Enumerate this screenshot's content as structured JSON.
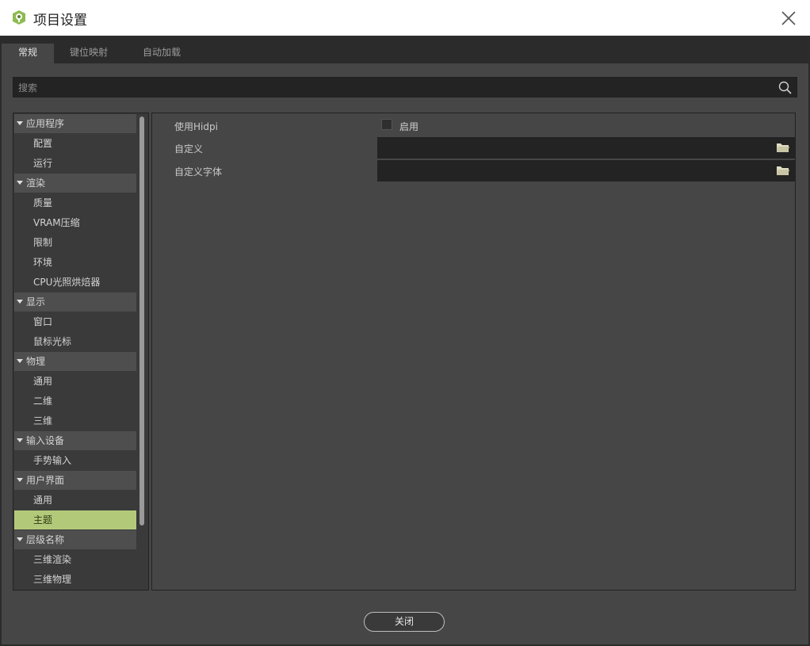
{
  "window": {
    "title": "项目设置"
  },
  "tabs": [
    {
      "label": "常规",
      "active": true
    },
    {
      "label": "键位映射",
      "active": false
    },
    {
      "label": "自动加载",
      "active": false
    }
  ],
  "search": {
    "placeholder": "搜索",
    "value": ""
  },
  "tree": {
    "sections": [
      {
        "label": "应用程序",
        "children": [
          "配置",
          "运行"
        ]
      },
      {
        "label": "渲染",
        "children": [
          "质量",
          "VRAM压缩",
          "限制",
          "环境",
          "CPU光照烘焙器"
        ]
      },
      {
        "label": "显示",
        "children": [
          "窗口",
          "鼠标光标"
        ]
      },
      {
        "label": "物理",
        "children": [
          "通用",
          "二维",
          "三维"
        ]
      },
      {
        "label": "输入设备",
        "children": [
          "手势输入"
        ]
      },
      {
        "label": "用户界面",
        "children": [
          "通用",
          "主题"
        ]
      },
      {
        "label": "层级名称",
        "children": [
          "三维渲染",
          "三维物理"
        ]
      }
    ],
    "selected": "主题"
  },
  "properties": [
    {
      "label": "使用Hidpi",
      "type": "checkbox",
      "checkbox_label": "启用",
      "checked": false
    },
    {
      "label": "自定义",
      "type": "path",
      "value": ""
    },
    {
      "label": "自定义字体",
      "type": "path",
      "value": ""
    }
  ],
  "footer": {
    "close_label": "关闭"
  },
  "colors": {
    "accent": "#b3c97a",
    "panel_bg": "#464646",
    "field_bg": "#232323",
    "logo_green": "#8dbb52"
  },
  "icons": {
    "logo": "godot-logo-icon",
    "close": "close-icon",
    "search": "search-icon",
    "folder": "folder-icon",
    "expand": "triangle-down-icon"
  }
}
